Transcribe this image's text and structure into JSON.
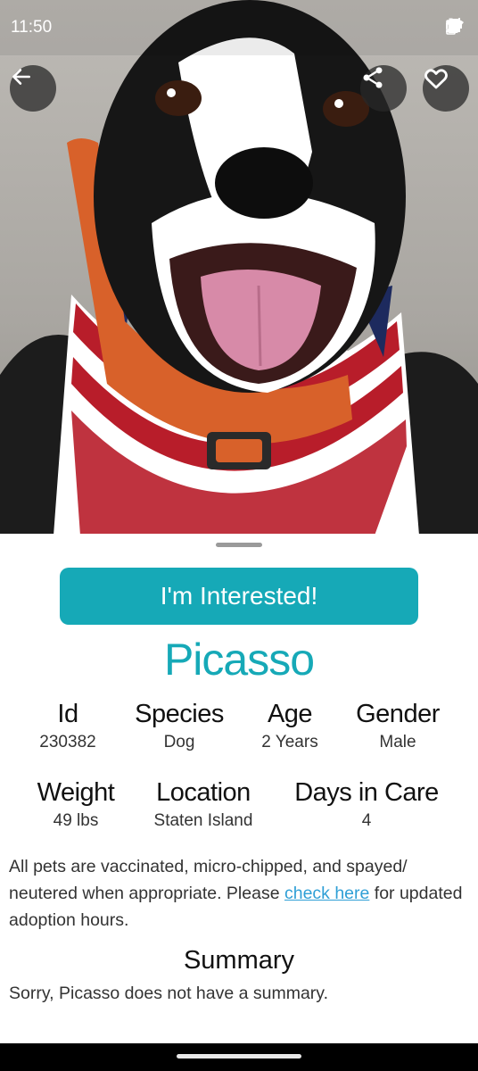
{
  "status_bar": {
    "time": "11:50"
  },
  "actions": {
    "back": "arrow-left-icon",
    "share": "share-icon",
    "favorite": "heart-icon"
  },
  "cta": {
    "label": "I'm Interested!"
  },
  "pet": {
    "name": "Picasso",
    "facts_row1": [
      {
        "label": "Id",
        "value": "230382"
      },
      {
        "label": "Species",
        "value": "Dog"
      },
      {
        "label": "Age",
        "value": "2 Years"
      },
      {
        "label": "Gender",
        "value": "Male"
      }
    ],
    "facts_row2": [
      {
        "label": "Weight",
        "value": "49 lbs"
      },
      {
        "label": "Location",
        "value": "Staten Island"
      },
      {
        "label": "Days in Care",
        "value": "4"
      }
    ]
  },
  "notice": {
    "before": "All pets are vaccinated, micro-chipped, and spayed/ neutered when appropriate. Please ",
    "link": "check here",
    "after": " for updated adoption hours."
  },
  "summary": {
    "title": "Summary",
    "text": "Sorry, Picasso does not have a summary."
  },
  "colors": {
    "accent": "#16a9b7",
    "link": "#2f9fd6"
  }
}
